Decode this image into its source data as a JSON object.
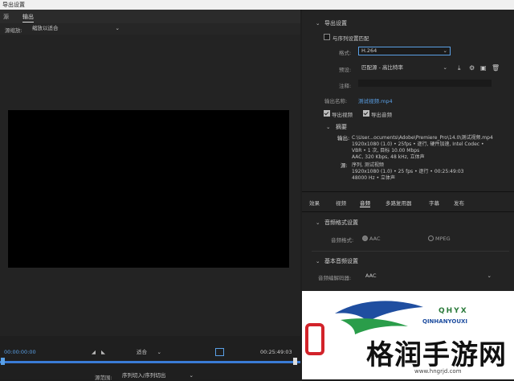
{
  "window": {
    "title": "导出设置"
  },
  "left_tabs": [
    {
      "label": "源"
    },
    {
      "label": "输出"
    }
  ],
  "source_scale": {
    "label": "源缩放:",
    "value": "缩放以适合"
  },
  "timeline": {
    "start_time": "00:00:00:00",
    "end_time": "00:25:49:03",
    "fit_value": "适合",
    "range_label": "源范围:",
    "range_value": "序列切入/序列切出"
  },
  "export_settings": {
    "section_title": "导出设置",
    "match_sequence_label": "与序列设置匹配",
    "format_label": "格式:",
    "format_value": "H.264",
    "preset_label": "预设:",
    "preset_value": "匹配源 - 高比特率",
    "comment_label": "注释:",
    "comment_value": "",
    "output_name_label": "输出名称:",
    "output_name_value": "测试视频.mp4",
    "export_video_label": "导出视频",
    "export_audio_label": "导出音频"
  },
  "summary": {
    "title": "摘要",
    "output_label": "输出:",
    "output_lines": [
      "C:\\User...ocuments\\Adobe\\Premiere_Pro\\14.0\\测试视频.mp4",
      "1920x1080 (1.0) • 25fps • 逐行, 硬件加速, Intel Codec •",
      "VBR • 1 次, 目标 10.00 Mbps",
      "AAC, 320 Kbps, 48  kHz, 立体声"
    ],
    "source_label": "源:",
    "source_lines": [
      "序列, 测试视频",
      "1920x1080 (1.0) • 25 fps • 逐行 • 00:25:49:03",
      "48000 Hz • 立体声"
    ]
  },
  "settings_tabs": [
    {
      "label": "效果"
    },
    {
      "label": "视频"
    },
    {
      "label": "音频"
    },
    {
      "label": "多路复用器"
    },
    {
      "label": "字幕"
    },
    {
      "label": "发布"
    }
  ],
  "audio_format": {
    "section_title": "音频格式设置",
    "label": "音频格式:",
    "options": [
      "AAC",
      "MPEG"
    ]
  },
  "basic_audio": {
    "section_title": "基本音频设置",
    "codec_label": "音频编解码器:",
    "codec_value": "AAC"
  },
  "watermark": {
    "brand_text": "格润手游网",
    "url": "www.hngrjd.com",
    "logo_text": "QINHANYOUXI",
    "logo_letters": "QHYX"
  },
  "colors": {
    "accent": "#5aa0e6",
    "brand_red": "#d2232a"
  }
}
